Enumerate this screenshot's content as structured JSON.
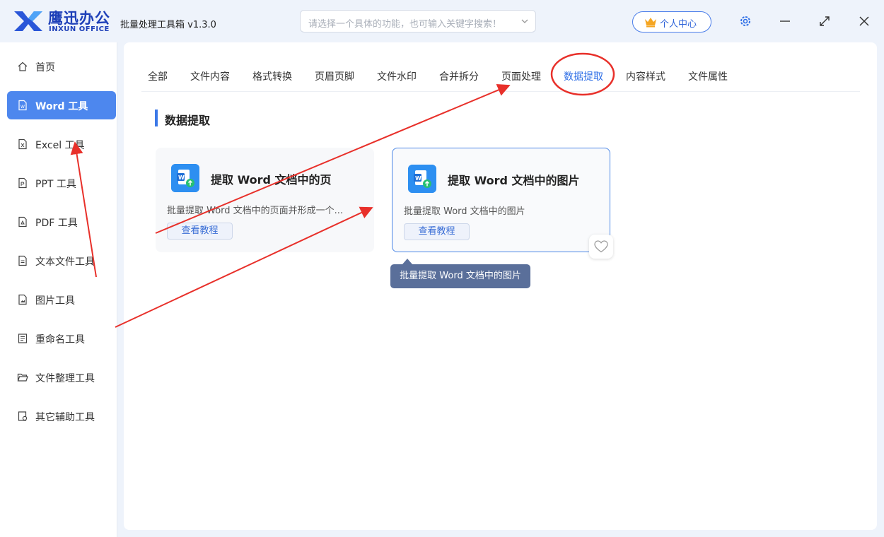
{
  "app": {
    "brand_cn": "鹰迅办公",
    "brand_en": "INXUN OFFICE",
    "title": "批量处理工具箱 v1.3.0",
    "search_placeholder": "请选择一个具体的功能，也可输入关键字搜索！",
    "user_center": "个人中心"
  },
  "sidebar": {
    "items": [
      {
        "label": "首页",
        "icon": "home-icon"
      },
      {
        "label": "Word 工具",
        "icon": "word-file-icon",
        "active": true
      },
      {
        "label": "Excel 工具",
        "icon": "excel-file-icon"
      },
      {
        "label": "PPT 工具",
        "icon": "ppt-file-icon"
      },
      {
        "label": "PDF 工具",
        "icon": "pdf-file-icon"
      },
      {
        "label": "文本文件工具",
        "icon": "text-file-icon"
      },
      {
        "label": "图片工具",
        "icon": "image-file-icon"
      },
      {
        "label": "重命名工具",
        "icon": "rename-icon"
      },
      {
        "label": "文件整理工具",
        "icon": "folder-icon"
      },
      {
        "label": "其它辅助工具",
        "icon": "misc-tool-icon"
      }
    ]
  },
  "tabs": [
    {
      "label": "全部"
    },
    {
      "label": "文件内容"
    },
    {
      "label": "格式转换"
    },
    {
      "label": "页眉页脚"
    },
    {
      "label": "文件水印"
    },
    {
      "label": "合并拆分"
    },
    {
      "label": "页面处理"
    },
    {
      "label": "数据提取",
      "active": true
    },
    {
      "label": "内容样式"
    },
    {
      "label": "文件属性"
    }
  ],
  "section": {
    "title": "数据提取"
  },
  "cards": [
    {
      "title": "提取 Word 文档中的页",
      "desc": "批量提取 Word 文档中的页面并形成一个...",
      "button": "查看教程"
    },
    {
      "title": "提取 Word 文档中的图片",
      "desc": "批量提取 Word 文档中的图片",
      "button": "查看教程"
    }
  ],
  "tooltip": "批量提取 Word 文档中的图片",
  "colors": {
    "accent": "#4d87ee",
    "brand": "#1d3fb8",
    "annotation": "#e8302a"
  }
}
